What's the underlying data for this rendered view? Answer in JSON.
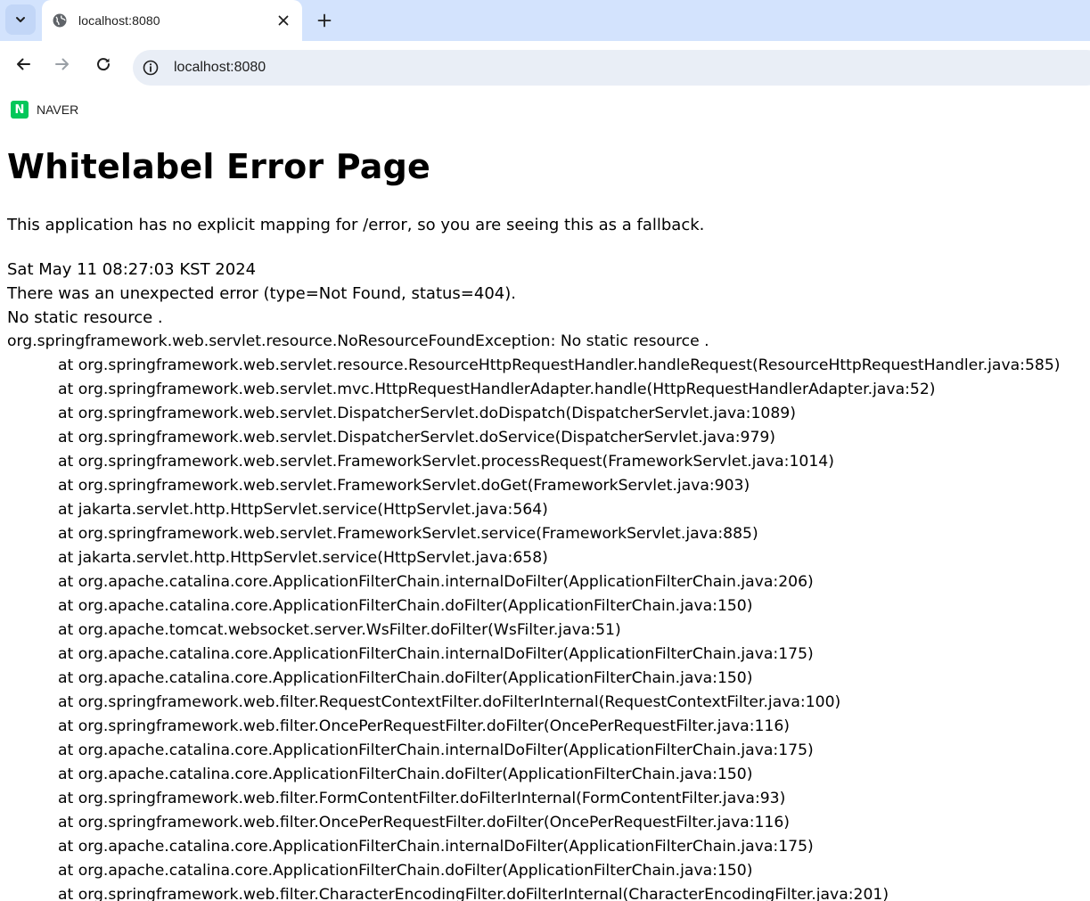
{
  "browser": {
    "tab_title": "localhost:8080",
    "url": "localhost:8080",
    "bookmarks": [
      {
        "label": "NAVER",
        "icon": "naver-logo",
        "icon_letter": "N"
      }
    ]
  },
  "page": {
    "title": "Whitelabel Error Page",
    "fallback_message": "This application has no explicit mapping for /error, so you are seeing this as a fallback.",
    "timestamp": "Sat May 11 08:27:03 KST 2024",
    "error_summary": "There was an unexpected error (type=Not Found, status=404).",
    "message": "No static resource .",
    "exception": "org.springframework.web.servlet.resource.NoResourceFoundException: No static resource .",
    "stack_trace": [
      "at org.springframework.web.servlet.resource.ResourceHttpRequestHandler.handleRequest(ResourceHttpRequestHandler.java:585)",
      "at org.springframework.web.servlet.mvc.HttpRequestHandlerAdapter.handle(HttpRequestHandlerAdapter.java:52)",
      "at org.springframework.web.servlet.DispatcherServlet.doDispatch(DispatcherServlet.java:1089)",
      "at org.springframework.web.servlet.DispatcherServlet.doService(DispatcherServlet.java:979)",
      "at org.springframework.web.servlet.FrameworkServlet.processRequest(FrameworkServlet.java:1014)",
      "at org.springframework.web.servlet.FrameworkServlet.doGet(FrameworkServlet.java:903)",
      "at jakarta.servlet.http.HttpServlet.service(HttpServlet.java:564)",
      "at org.springframework.web.servlet.FrameworkServlet.service(FrameworkServlet.java:885)",
      "at jakarta.servlet.http.HttpServlet.service(HttpServlet.java:658)",
      "at org.apache.catalina.core.ApplicationFilterChain.internalDoFilter(ApplicationFilterChain.java:206)",
      "at org.apache.catalina.core.ApplicationFilterChain.doFilter(ApplicationFilterChain.java:150)",
      "at org.apache.tomcat.websocket.server.WsFilter.doFilter(WsFilter.java:51)",
      "at org.apache.catalina.core.ApplicationFilterChain.internalDoFilter(ApplicationFilterChain.java:175)",
      "at org.apache.catalina.core.ApplicationFilterChain.doFilter(ApplicationFilterChain.java:150)",
      "at org.springframework.web.filter.RequestContextFilter.doFilterInternal(RequestContextFilter.java:100)",
      "at org.springframework.web.filter.OncePerRequestFilter.doFilter(OncePerRequestFilter.java:116)",
      "at org.apache.catalina.core.ApplicationFilterChain.internalDoFilter(ApplicationFilterChain.java:175)",
      "at org.apache.catalina.core.ApplicationFilterChain.doFilter(ApplicationFilterChain.java:150)",
      "at org.springframework.web.filter.FormContentFilter.doFilterInternal(FormContentFilter.java:93)",
      "at org.springframework.web.filter.OncePerRequestFilter.doFilter(OncePerRequestFilter.java:116)",
      "at org.apache.catalina.core.ApplicationFilterChain.internalDoFilter(ApplicationFilterChain.java:175)",
      "at org.apache.catalina.core.ApplicationFilterChain.doFilter(ApplicationFilterChain.java:150)",
      "at org.springframework.web.filter.CharacterEncodingFilter.doFilterInternal(CharacterEncodingFilter.java:201)"
    ]
  },
  "colors": {
    "tabstrip_bg": "#d3e3fd",
    "omnibox_bg": "#e9eef6",
    "naver_green": "#03c75a"
  }
}
